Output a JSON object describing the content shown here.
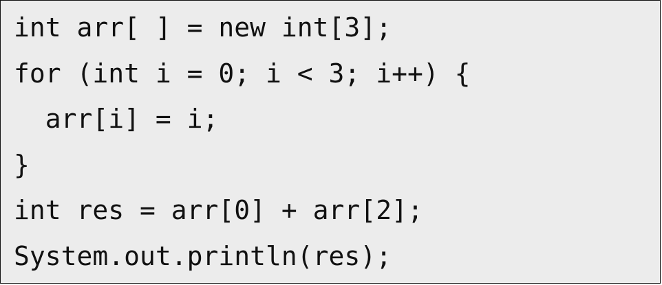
{
  "code": {
    "lines": [
      "int arr[ ] = new int[3];",
      "for (int i = 0; i < 3; i++) {",
      "  arr[i] = i;",
      "}",
      "int res = arr[0] + arr[2];",
      "System.out.println(res);"
    ]
  },
  "colors": {
    "background": "#ececec",
    "border": "#111111",
    "text": "#111111"
  }
}
